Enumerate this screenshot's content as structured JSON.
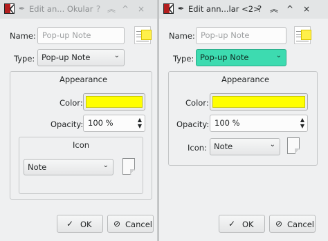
{
  "colors": {
    "annotation_color": "#ffff00",
    "type_focus": "#3ddbb0"
  },
  "windows": [
    {
      "title": "Edit an... Okular",
      "pin_icon": "pin-icon",
      "titlebar_buttons": [
        "?",
        "︽",
        "^",
        "×"
      ],
      "name_label": "Name:",
      "name_placeholder": "Pop-up Note",
      "type_label": "Type:",
      "type_value": "Pop-up Note",
      "appearance_title": "Appearance",
      "color_label": "Color:",
      "opacity_label": "Opacity:",
      "opacity_value": "100 %",
      "icon_group_title": "Icon",
      "icon_value": "Note",
      "ok_label": "OK",
      "cancel_label": "Cancel"
    },
    {
      "title": "Edit ann...lar <2>",
      "pin_icon": "pin-icon",
      "titlebar_buttons": [
        "?",
        "︽",
        "^",
        "×"
      ],
      "name_label": "Name:",
      "name_placeholder": "Pop-up Note",
      "type_label": "Type:",
      "type_value": "Pop-up Note",
      "appearance_title": "Appearance",
      "color_label": "Color:",
      "opacity_label": "Opacity:",
      "opacity_value": "100 %",
      "icon_label": "Icon:",
      "icon_value": "Note",
      "ok_label": "OK",
      "cancel_label": "Cancel"
    }
  ]
}
